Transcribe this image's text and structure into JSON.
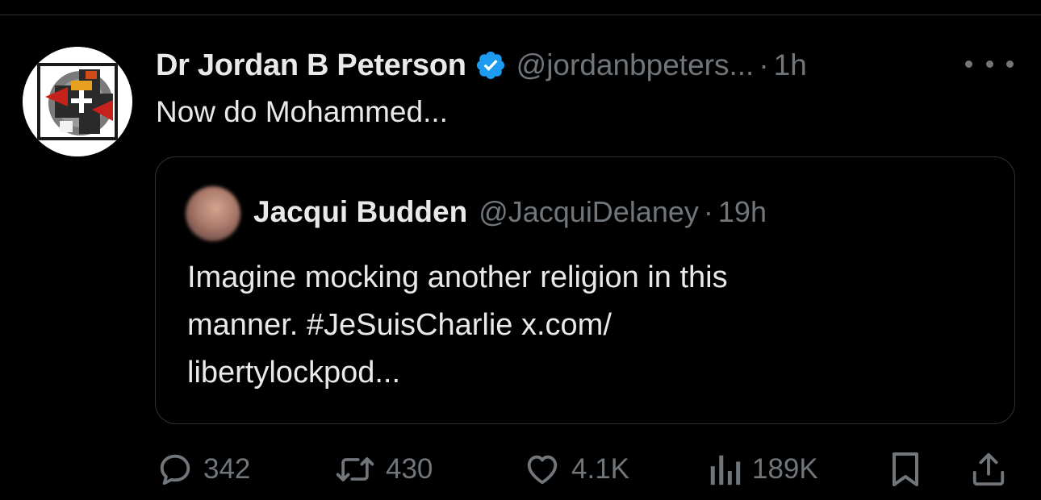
{
  "tweet": {
    "display_name": "Dr Jordan B Peterson",
    "handle": "@jordanbpeters...",
    "separator": "·",
    "time": "1h",
    "text": "Now do Mohammed...",
    "verified_color": "#1d9bf0"
  },
  "quoted_tweet": {
    "display_name": "Jacqui Budden",
    "handle": "@JacquiDelaney",
    "separator": "·",
    "time": "19h",
    "text_lines": [
      "Imagine mocking another religion in this",
      "manner. #JeSuisCharlie x.com/",
      "libertylockpod..."
    ]
  },
  "actions": {
    "replies": "342",
    "reposts": "430",
    "likes": "4.1K",
    "views": "189K"
  },
  "icons": {
    "more": "more-icon",
    "reply": "reply-icon",
    "repost": "repost-icon",
    "like": "like-icon",
    "views": "views-icon",
    "bookmark": "bookmark-icon",
    "share": "share-icon",
    "verified": "verified-badge-icon"
  },
  "colors": {
    "background": "#000000",
    "text_primary": "#e7e9ea",
    "text_secondary": "#71767b",
    "border": "#2f3336"
  }
}
